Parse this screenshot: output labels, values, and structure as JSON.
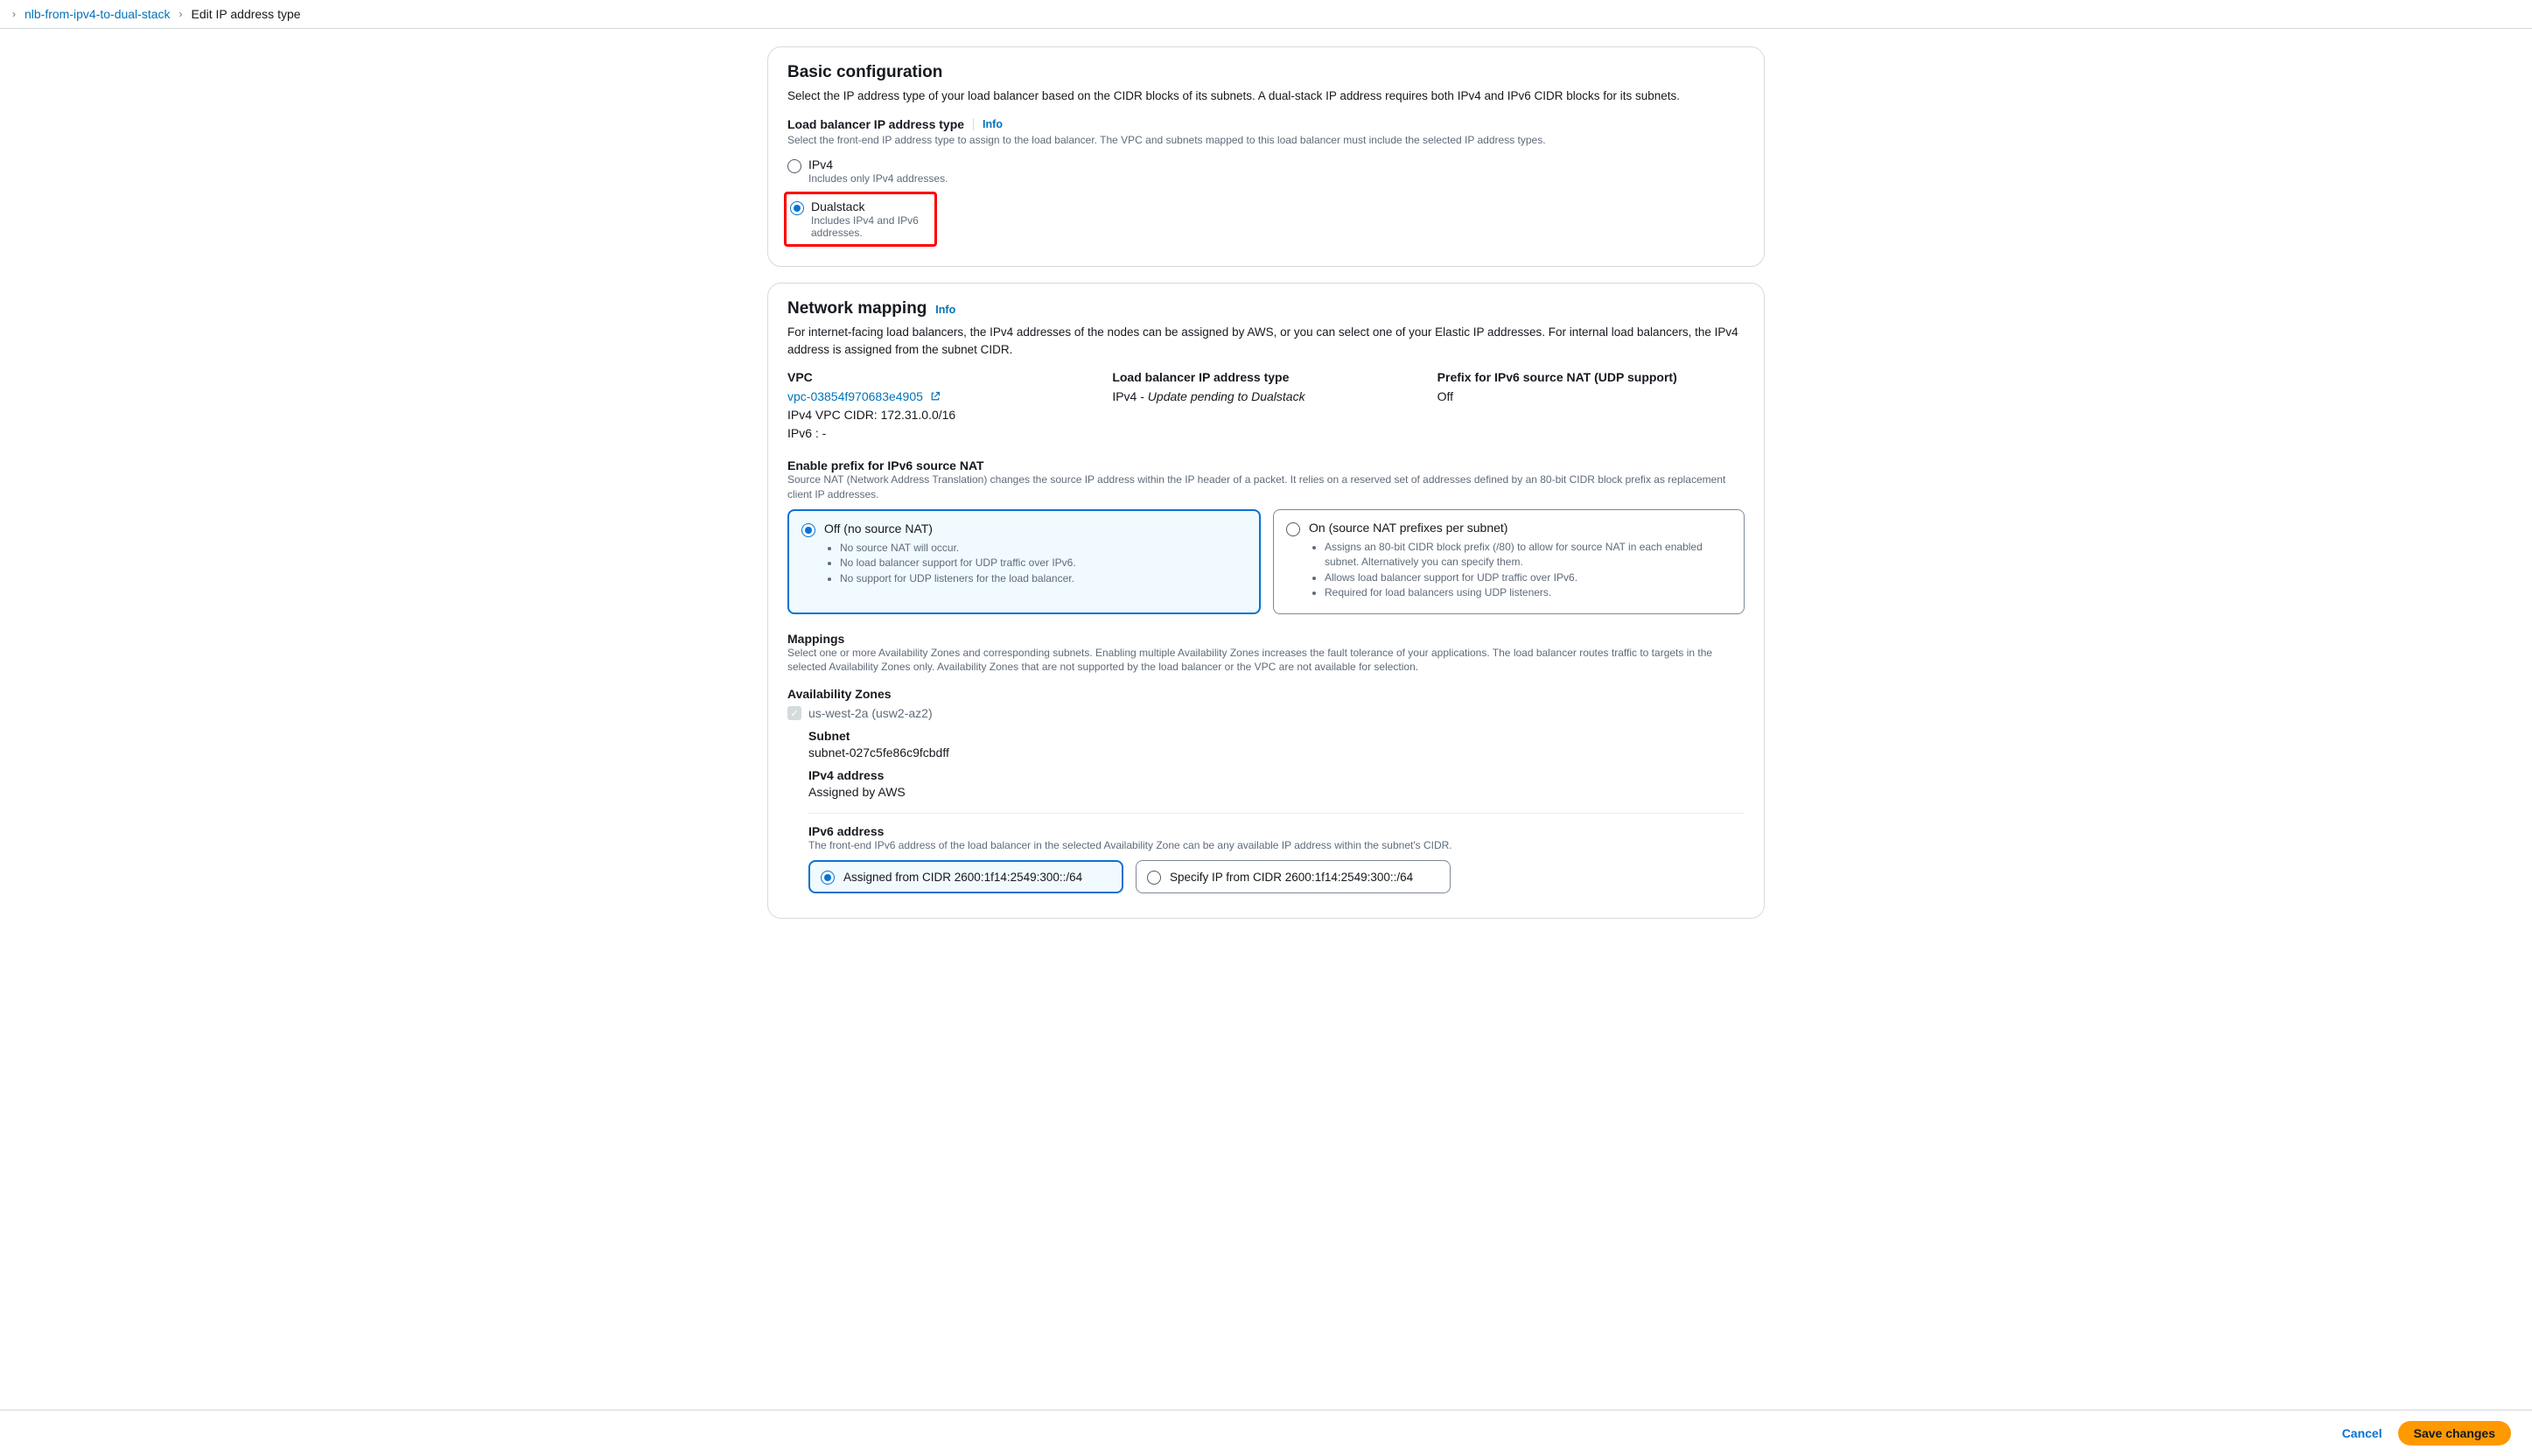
{
  "breadcrumb": {
    "parent": "nlb-from-ipv4-to-dual-stack",
    "current": "Edit IP address type"
  },
  "basic": {
    "title": "Basic configuration",
    "desc": "Select the IP address type of your load balancer based on the CIDR blocks of its subnets. A dual-stack IP address requires both IPv4 and IPv6 CIDR blocks for its subnets.",
    "field_label": "Load balancer IP address type",
    "info": "Info",
    "helper": "Select the front-end IP address type to assign to the load balancer. The VPC and subnets mapped to this load balancer must include the selected IP address types.",
    "options": [
      {
        "label": "IPv4",
        "sub": "Includes only IPv4 addresses.",
        "selected": false
      },
      {
        "label": "Dualstack",
        "sub": "Includes IPv4 and IPv6 addresses.",
        "selected": true
      }
    ]
  },
  "network": {
    "title": "Network mapping",
    "info": "Info",
    "desc": "For internet-facing load balancers, the IPv4 addresses of the nodes can be assigned by AWS, or you can select one of your Elastic IP addresses. For internal load balancers, the IPv4 address is assigned from the subnet CIDR.",
    "vpc": {
      "label": "VPC",
      "id": "vpc-03854f970683e4905",
      "ipv4_cidr": "IPv4 VPC CIDR: 172.31.0.0/16",
      "ipv6": "IPv6 : -"
    },
    "ip_type": {
      "label": "Load balancer IP address type",
      "value_prefix": "IPv4 - ",
      "value_italic": "Update pending to Dualstack"
    },
    "prefix_nat": {
      "label": "Prefix for IPv6 source NAT (UDP support)",
      "value": "Off"
    },
    "source_nat": {
      "label": "Enable prefix for IPv6 source NAT",
      "helper": "Source NAT (Network Address Translation) changes the source IP address within the IP header of a packet. It relies on a reserved set of addresses defined by an 80-bit CIDR block prefix as replacement client IP addresses.",
      "off": {
        "title": "Off (no source NAT)",
        "bullets": [
          "No source NAT will occur.",
          "No load balancer support for UDP traffic over IPv6.",
          "No support for UDP listeners for the load balancer."
        ]
      },
      "on": {
        "title": "On (source NAT prefixes per subnet)",
        "bullets": [
          "Assigns an 80-bit CIDR block prefix (/80) to allow for source NAT in each enabled subnet. Alternatively you can specify them.",
          "Allows load balancer support for UDP traffic over IPv6.",
          "Required for load balancers using UDP listeners."
        ]
      }
    },
    "mappings": {
      "label": "Mappings",
      "helper": "Select one or more Availability Zones and corresponding subnets. Enabling multiple Availability Zones increases the fault tolerance of your applications. The load balancer routes traffic to targets in the selected Availability Zones only. Availability Zones that are not supported by the load balancer or the VPC are not available for selection."
    },
    "azs": {
      "label": "Availability Zones",
      "zone": "us-west-2a (usw2-az2)",
      "subnet_label": "Subnet",
      "subnet_value": "subnet-027c5fe86c9fcbdff",
      "ipv4_label": "IPv4 address",
      "ipv4_value": "Assigned by AWS",
      "ipv6_label": "IPv6 address",
      "ipv6_helper": "The front-end IPv6 address of the load balancer in the selected Availability Zone can be any available IP address within the subnet's CIDR.",
      "ipv6_assigned": "Assigned from CIDR 2600:1f14:2549:300::/64",
      "ipv6_specify": "Specify IP from CIDR 2600:1f14:2549:300::/64"
    }
  },
  "footer": {
    "cancel": "Cancel",
    "save": "Save changes"
  }
}
